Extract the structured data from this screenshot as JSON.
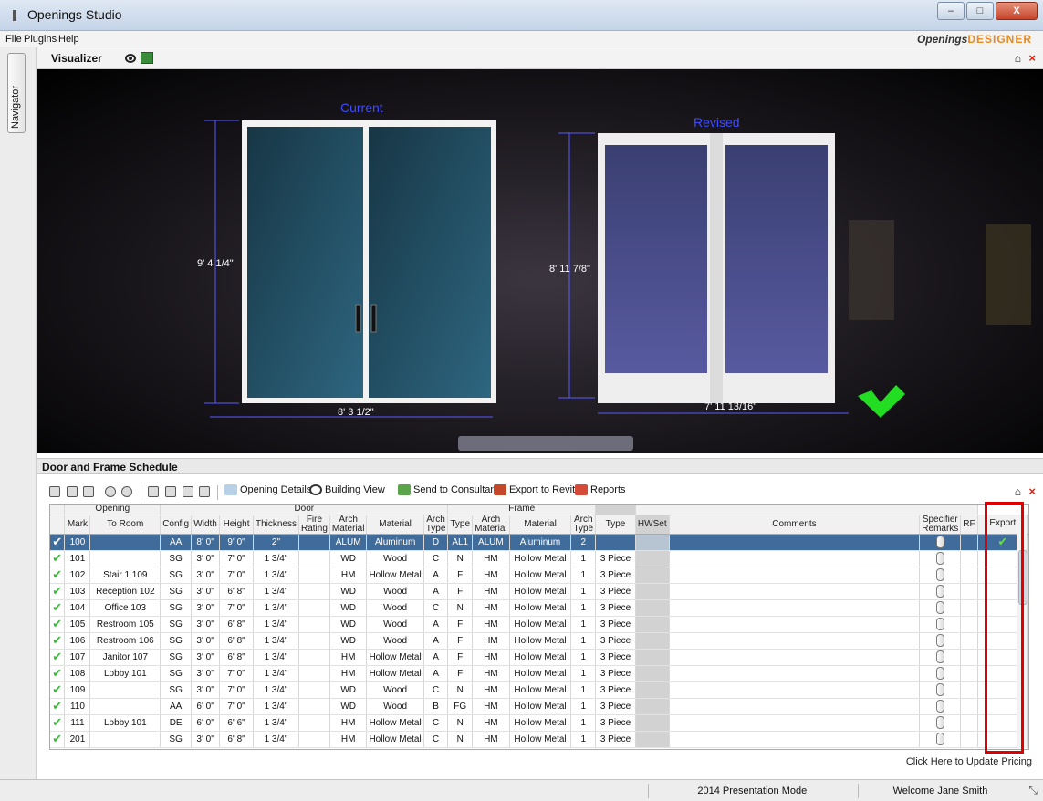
{
  "window": {
    "title": "Openings Studio",
    "min": "–",
    "max": "□",
    "close": "X"
  },
  "menu": {
    "items": [
      "File",
      "Plugins",
      "Help"
    ],
    "brand_main": "Openings",
    "brand_accent": "DESIGNER"
  },
  "navigator": {
    "label": "Navigator"
  },
  "visualizer": {
    "label": "Visualizer",
    "current_label": "Current",
    "revised_label": "Revised",
    "current_height": "9' 4 1/4\"",
    "current_width": "8' 3 1/2\"",
    "revised_height": "8' 11 7/8\"",
    "revised_width": "7' 11 13/16\""
  },
  "schedule": {
    "label": "Door and Frame Schedule",
    "toolbar": {
      "opening_details": "Opening Details",
      "building_view": "Building View",
      "send_to_consultant": "Send to Consultant",
      "export_to_revit": "Export to Revit",
      "reports": "Reports"
    },
    "groups": {
      "opening": "Opening",
      "door": "Door",
      "frame": "Frame"
    },
    "columns": {
      "mark": "Mark",
      "to_room": "To Room",
      "config": "Config",
      "width": "Width",
      "height": "Height",
      "thickness": "Thickness",
      "fire_rating": "Fire Rating",
      "door_arch_material": "Arch Material",
      "door_material": "Material",
      "door_arch_type": "Arch Type",
      "door_type": "Type",
      "frame_arch_material": "Arch Material",
      "frame_material": "Material",
      "frame_arch_type": "Arch Type",
      "frame_type": "Type",
      "hwset": "HWSet",
      "comments": "Comments",
      "specifier_remarks": "Specifier Remarks",
      "rf": "RF",
      "export": "Export"
    },
    "rows": [
      {
        "mark": "100",
        "room": "",
        "config": "AA",
        "width": "8' 0\"",
        "height": "9' 0\"",
        "thickness": "2\"",
        "fire": "",
        "d_arch_mat": "ALUM",
        "d_mat": "Aluminum",
        "d_arch_type": "D",
        "d_type": "AL1",
        "f_arch_mat": "ALUM",
        "f_mat": "Aluminum",
        "f_arch_type": "2",
        "f_type": "",
        "export": "✔"
      },
      {
        "mark": "101",
        "room": "",
        "config": "SG",
        "width": "3' 0\"",
        "height": "7' 0\"",
        "thickness": "1 3/4\"",
        "fire": "",
        "d_arch_mat": "WD",
        "d_mat": "Wood",
        "d_arch_type": "C",
        "d_type": "N",
        "f_arch_mat": "HM",
        "f_mat": "Hollow Metal",
        "f_arch_type": "1",
        "f_type": "3 Piece",
        "export": ""
      },
      {
        "mark": "102",
        "room": "Stair 1 109",
        "config": "SG",
        "width": "3' 0\"",
        "height": "7' 0\"",
        "thickness": "1 3/4\"",
        "fire": "",
        "d_arch_mat": "HM",
        "d_mat": "Hollow Metal",
        "d_arch_type": "A",
        "d_type": "F",
        "f_arch_mat": "HM",
        "f_mat": "Hollow Metal",
        "f_arch_type": "1",
        "f_type": "3 Piece",
        "export": ""
      },
      {
        "mark": "103",
        "room": "Reception 102",
        "config": "SG",
        "width": "3' 0\"",
        "height": "6' 8\"",
        "thickness": "1 3/4\"",
        "fire": "",
        "d_arch_mat": "WD",
        "d_mat": "Wood",
        "d_arch_type": "A",
        "d_type": "F",
        "f_arch_mat": "HM",
        "f_mat": "Hollow Metal",
        "f_arch_type": "1",
        "f_type": "3 Piece",
        "export": ""
      },
      {
        "mark": "104",
        "room": "Office 103",
        "config": "SG",
        "width": "3' 0\"",
        "height": "7' 0\"",
        "thickness": "1 3/4\"",
        "fire": "",
        "d_arch_mat": "WD",
        "d_mat": "Wood",
        "d_arch_type": "C",
        "d_type": "N",
        "f_arch_mat": "HM",
        "f_mat": "Hollow Metal",
        "f_arch_type": "1",
        "f_type": "3 Piece",
        "export": ""
      },
      {
        "mark": "105",
        "room": "Restroom 105",
        "config": "SG",
        "width": "3' 0\"",
        "height": "6' 8\"",
        "thickness": "1 3/4\"",
        "fire": "",
        "d_arch_mat": "WD",
        "d_mat": "Wood",
        "d_arch_type": "A",
        "d_type": "F",
        "f_arch_mat": "HM",
        "f_mat": "Hollow Metal",
        "f_arch_type": "1",
        "f_type": "3 Piece",
        "export": ""
      },
      {
        "mark": "106",
        "room": "Restroom 106",
        "config": "SG",
        "width": "3' 0\"",
        "height": "6' 8\"",
        "thickness": "1 3/4\"",
        "fire": "",
        "d_arch_mat": "WD",
        "d_mat": "Wood",
        "d_arch_type": "A",
        "d_type": "F",
        "f_arch_mat": "HM",
        "f_mat": "Hollow Metal",
        "f_arch_type": "1",
        "f_type": "3 Piece",
        "export": ""
      },
      {
        "mark": "107",
        "room": "Janitor 107",
        "config": "SG",
        "width": "3' 0\"",
        "height": "6' 8\"",
        "thickness": "1 3/4\"",
        "fire": "",
        "d_arch_mat": "HM",
        "d_mat": "Hollow Metal",
        "d_arch_type": "A",
        "d_type": "F",
        "f_arch_mat": "HM",
        "f_mat": "Hollow Metal",
        "f_arch_type": "1",
        "f_type": "3 Piece",
        "export": ""
      },
      {
        "mark": "108",
        "room": "Lobby 101",
        "config": "SG",
        "width": "3' 0\"",
        "height": "7' 0\"",
        "thickness": "1 3/4\"",
        "fire": "",
        "d_arch_mat": "HM",
        "d_mat": "Hollow Metal",
        "d_arch_type": "A",
        "d_type": "F",
        "f_arch_mat": "HM",
        "f_mat": "Hollow Metal",
        "f_arch_type": "1",
        "f_type": "3 Piece",
        "export": ""
      },
      {
        "mark": "109",
        "room": "",
        "config": "SG",
        "width": "3' 0\"",
        "height": "7' 0\"",
        "thickness": "1 3/4\"",
        "fire": "",
        "d_arch_mat": "WD",
        "d_mat": "Wood",
        "d_arch_type": "C",
        "d_type": "N",
        "f_arch_mat": "HM",
        "f_mat": "Hollow Metal",
        "f_arch_type": "1",
        "f_type": "3 Piece",
        "export": ""
      },
      {
        "mark": "110",
        "room": "",
        "config": "AA",
        "width": "6' 0\"",
        "height": "7' 0\"",
        "thickness": "1 3/4\"",
        "fire": "",
        "d_arch_mat": "WD",
        "d_mat": "Wood",
        "d_arch_type": "B",
        "d_type": "FG",
        "f_arch_mat": "HM",
        "f_mat": "Hollow Metal",
        "f_arch_type": "1",
        "f_type": "3 Piece",
        "export": ""
      },
      {
        "mark": "111",
        "room": "Lobby 101",
        "config": "DE",
        "width": "6' 0\"",
        "height": "6' 6\"",
        "thickness": "1 3/4\"",
        "fire": "",
        "d_arch_mat": "HM",
        "d_mat": "Hollow Metal",
        "d_arch_type": "C",
        "d_type": "N",
        "f_arch_mat": "HM",
        "f_mat": "Hollow Metal",
        "f_arch_type": "1",
        "f_type": "3 Piece",
        "export": ""
      },
      {
        "mark": "201",
        "room": "",
        "config": "SG",
        "width": "3' 0\"",
        "height": "6' 8\"",
        "thickness": "1 3/4\"",
        "fire": "",
        "d_arch_mat": "HM",
        "d_mat": "Hollow Metal",
        "d_arch_type": "C",
        "d_type": "N",
        "f_arch_mat": "HM",
        "f_mat": "Hollow Metal",
        "f_arch_type": "1",
        "f_type": "3 Piece",
        "export": ""
      }
    ],
    "row_check": "✔",
    "pricing_link": "Click Here to Update Pricing"
  },
  "status": {
    "model": "2014 Presentation Model",
    "welcome": "Welcome Jane Smith"
  }
}
